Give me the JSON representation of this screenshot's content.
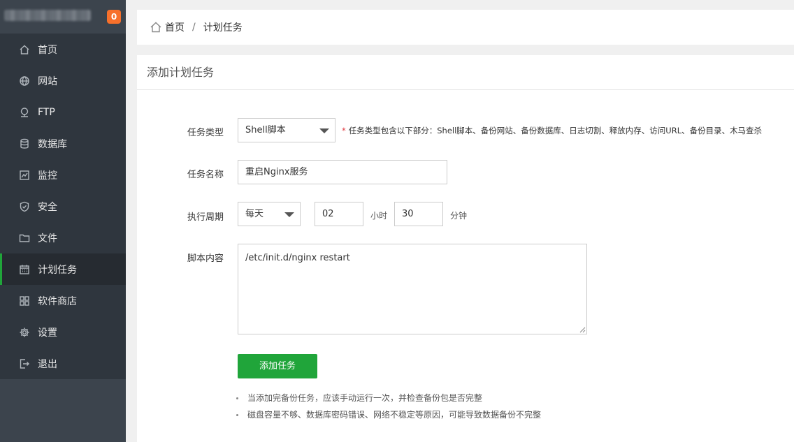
{
  "sidebar": {
    "badge": "0",
    "items": [
      {
        "label": "首页",
        "icon": "home-icon"
      },
      {
        "label": "网站",
        "icon": "globe-icon"
      },
      {
        "label": "FTP",
        "icon": "ftp-icon"
      },
      {
        "label": "数据库",
        "icon": "database-icon"
      },
      {
        "label": "监控",
        "icon": "monitor-icon"
      },
      {
        "label": "安全",
        "icon": "shield-icon"
      },
      {
        "label": "文件",
        "icon": "folder-icon"
      },
      {
        "label": "计划任务",
        "icon": "calendar-icon",
        "active": true
      },
      {
        "label": "软件商店",
        "icon": "grid-icon"
      },
      {
        "label": "设置",
        "icon": "gear-icon"
      },
      {
        "label": "退出",
        "icon": "logout-icon"
      }
    ]
  },
  "breadcrumb": {
    "home": "首页",
    "separator": "/",
    "current": "计划任务"
  },
  "panel": {
    "title": "添加计划任务"
  },
  "form": {
    "task_type": {
      "label": "任务类型",
      "value": "Shell脚本",
      "hint_star": "*",
      "hint": "任务类型包含以下部分：Shell脚本、备份网站、备份数据库、日志切割、释放内存、访问URL、备份目录、木马查杀"
    },
    "task_name": {
      "label": "任务名称",
      "value": "重启Nginx服务"
    },
    "period": {
      "label": "执行周期",
      "value": "每天",
      "hour": "02",
      "hour_unit": "小时",
      "minute": "30",
      "minute_unit": "分钟"
    },
    "script": {
      "label": "脚本内容",
      "value": "/etc/init.d/nginx restart"
    },
    "submit_label": "添加任务"
  },
  "tips": [
    "当添加完备份任务，应该手动运行一次，并检查备份包是否完整",
    "磁盘容量不够、数据库密码错误、网络不稳定等原因，可能导致数据备份不完整"
  ],
  "colors": {
    "accent": "#20a53a",
    "badge": "#f7702b",
    "sidebar": "#2f363e"
  }
}
